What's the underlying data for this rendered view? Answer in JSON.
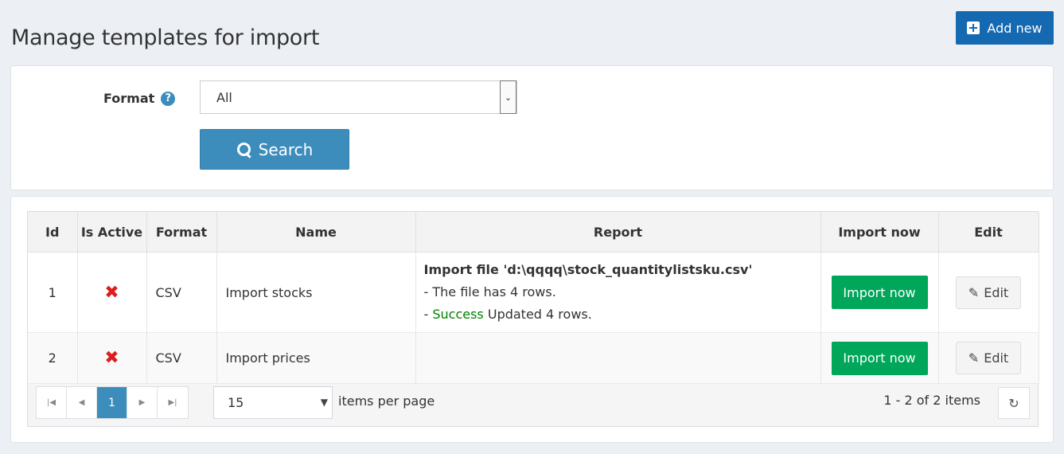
{
  "page": {
    "title": "Manage templates for import",
    "add_label": "Add new"
  },
  "filter": {
    "format_label": "Format",
    "help_glyph": "?",
    "format_value": "All",
    "search_label": "Search"
  },
  "table": {
    "columns": [
      "Id",
      "Is Active",
      "Format",
      "Name",
      "Report",
      "Import now",
      "Edit"
    ],
    "rows": [
      {
        "id": "1",
        "active_glyph": "✖",
        "format": "CSV",
        "name": "Import stocks",
        "report_title": "Import file 'd:\\qqqq\\stock_quantitylistsku.csv'",
        "report_line1": "- The file has 4 rows.",
        "report_line2_prefix": "- ",
        "report_line2_status": "Success",
        "report_line2_rest": " Updated 4 rows.",
        "import_label": "Import now",
        "edit_label": "Edit"
      },
      {
        "id": "2",
        "active_glyph": "✖",
        "format": "CSV",
        "name": "Import prices",
        "import_label": "Import now",
        "edit_label": "Edit"
      }
    ]
  },
  "pager": {
    "first": "|◀",
    "prev": "◀",
    "current": "1",
    "next": "▶",
    "last": "▶|",
    "page_size": "15",
    "items_per_page": "items per page",
    "count_text": "1 - 2 of 2 items",
    "refresh_glyph": "↻"
  },
  "colors": {
    "primary": "#3c8dbc",
    "add": "#1569b1",
    "success": "#00a65a",
    "danger": "#dd1e1e"
  }
}
